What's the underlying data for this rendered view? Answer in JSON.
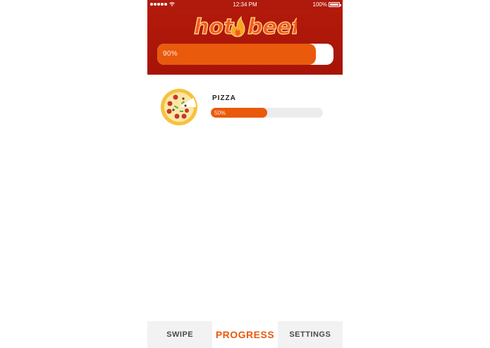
{
  "status_bar": {
    "time": "12:34 PM",
    "battery": "100%"
  },
  "app": {
    "logo_text_left": "hot",
    "logo_text_right": "beef",
    "accent_color": "#e95a0c",
    "header_color": "#b01a0c"
  },
  "overall_progress": {
    "label": "90%",
    "value": 0.9
  },
  "items": [
    {
      "name": "PIZZA",
      "label": "50%",
      "value": 0.5,
      "icon": "pizza-icon"
    }
  ],
  "tabs": [
    {
      "label": "SWIPE",
      "active": false
    },
    {
      "label": "PROGRESS",
      "active": true
    },
    {
      "label": "SETTINGS",
      "active": false
    }
  ]
}
